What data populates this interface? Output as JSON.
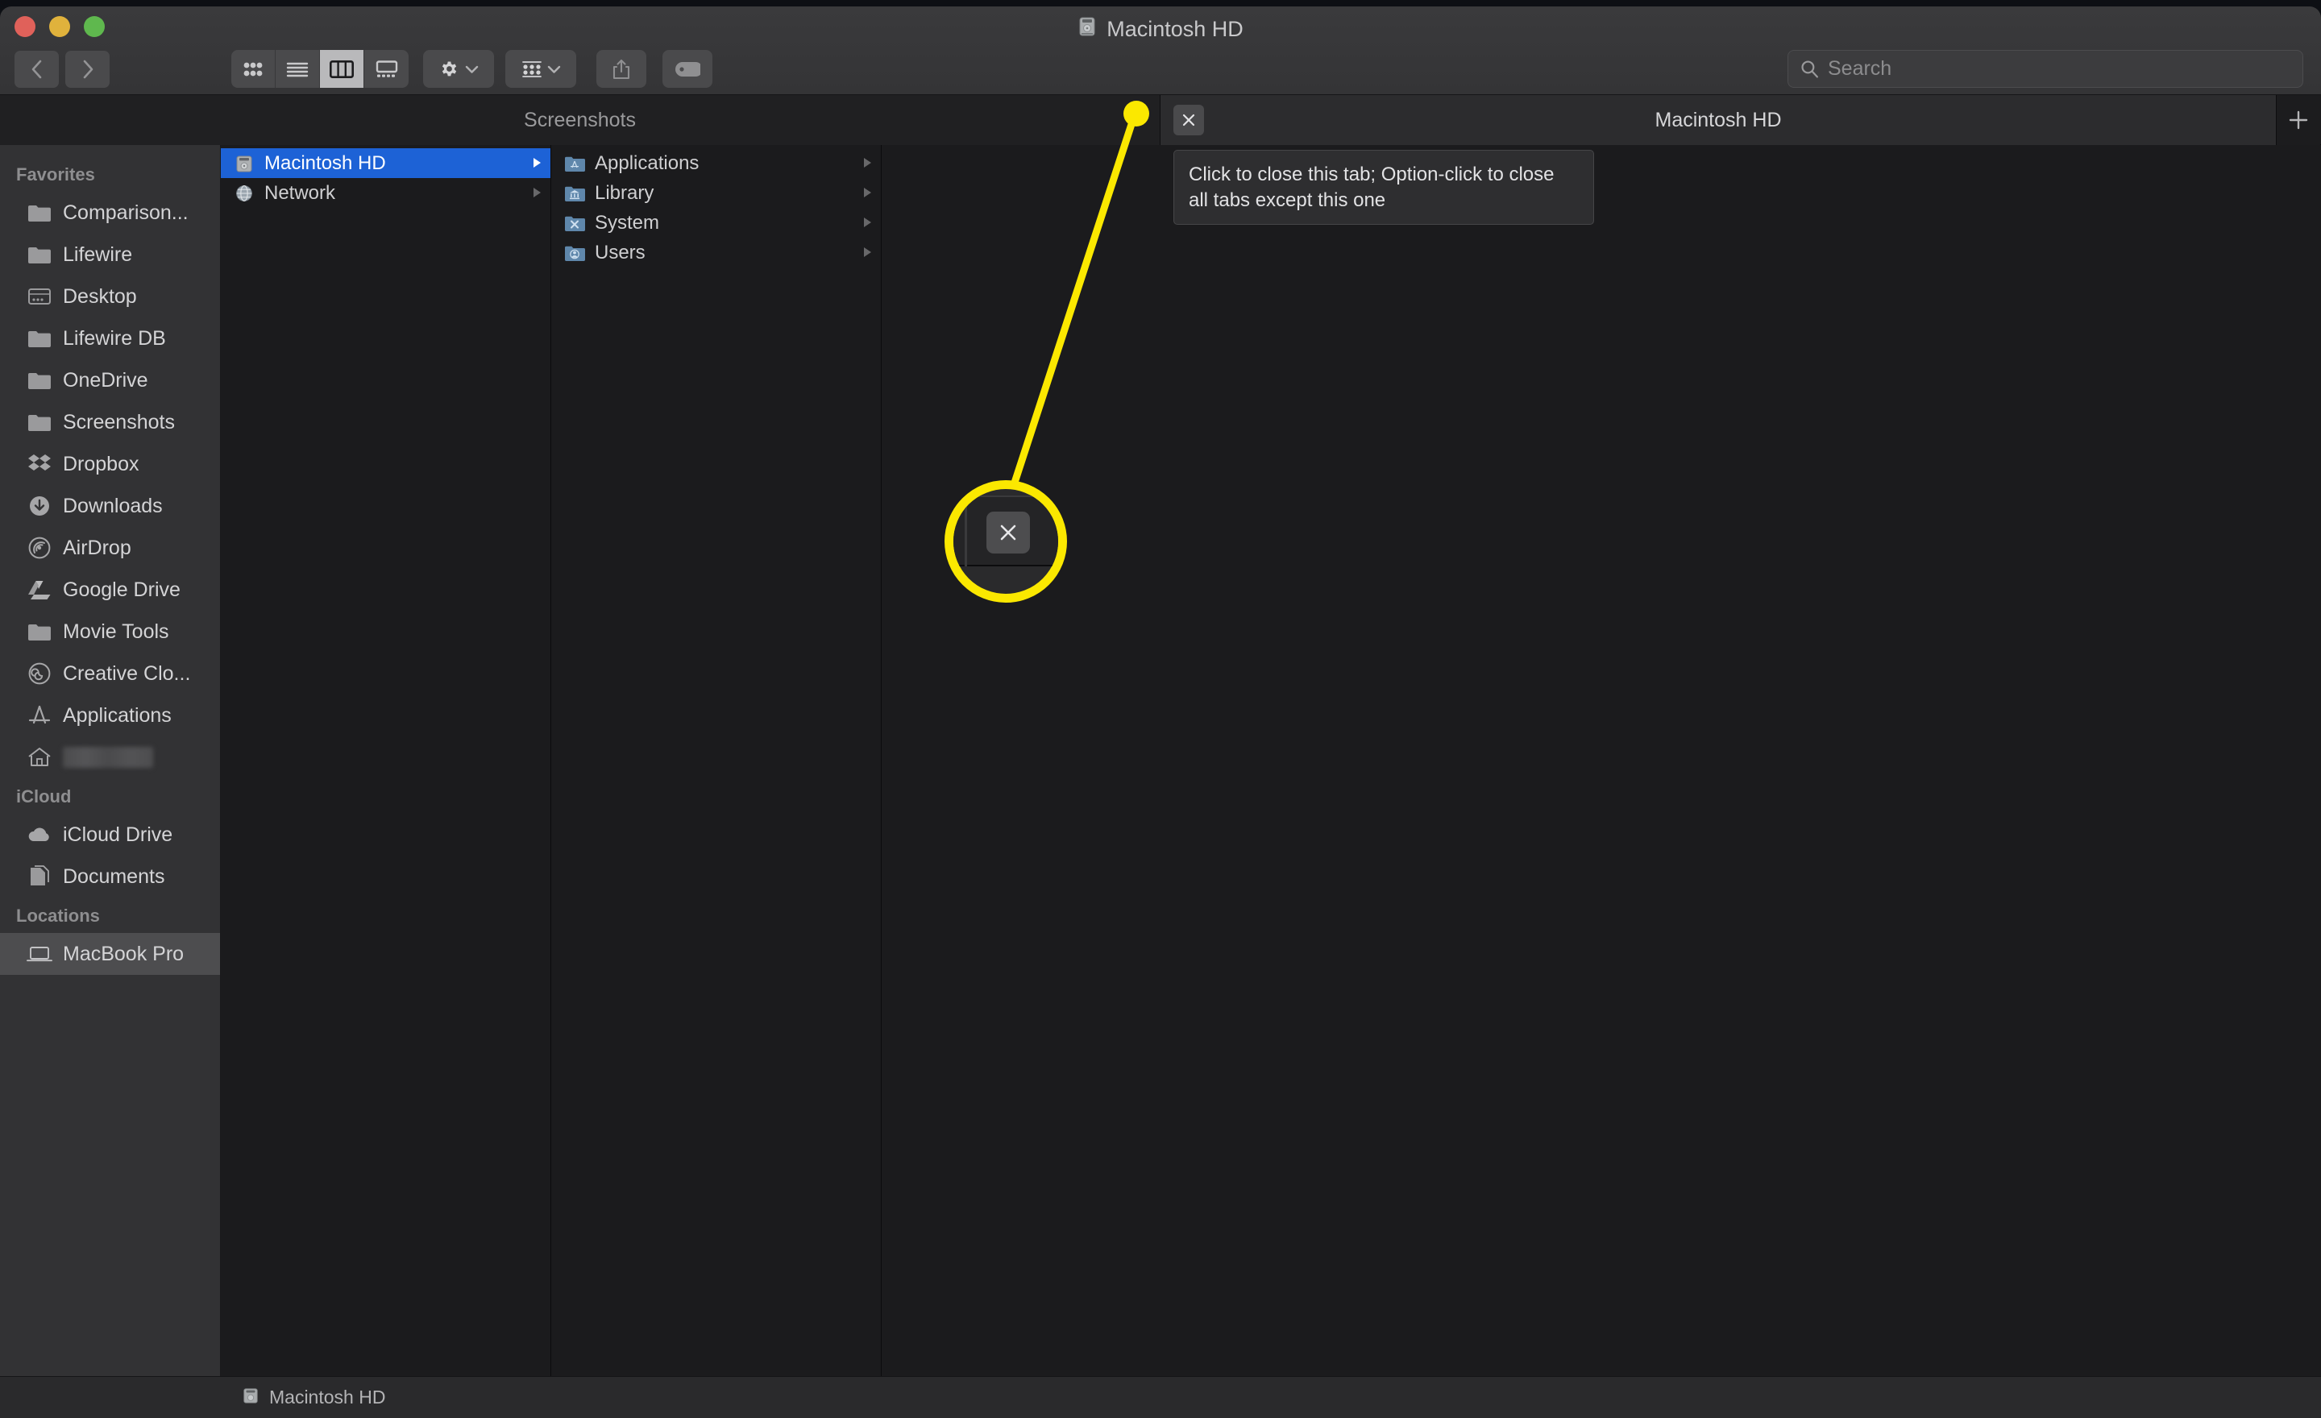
{
  "window": {
    "title": "Macintosh HD",
    "title_icon": "hard-drive-icon",
    "traffic_lights": [
      "close",
      "minimize",
      "zoom"
    ]
  },
  "toolbar": {
    "back_label": "Back",
    "forward_label": "Forward",
    "view_modes": [
      {
        "name": "icon-view",
        "label": "Icon View",
        "active": false
      },
      {
        "name": "list-view",
        "label": "List View",
        "active": false
      },
      {
        "name": "column-view",
        "label": "Column View",
        "active": true
      },
      {
        "name": "gallery-view",
        "label": "Gallery View",
        "active": false
      }
    ],
    "action_label": "Action",
    "arrange_label": "Arrange By",
    "share_label": "Share",
    "tags_label": "Edit Tags"
  },
  "search": {
    "placeholder": "Search",
    "value": ""
  },
  "tabs": {
    "items": [
      {
        "label": "Screenshots",
        "active": false,
        "has_close": false
      },
      {
        "label": "Macintosh HD",
        "active": true,
        "has_close": true
      }
    ],
    "new_tab_label": "+",
    "close_label": "✕"
  },
  "tooltip": {
    "text": "Click to close this tab; Option-click to close all tabs except this one"
  },
  "sidebar": {
    "sections": [
      {
        "header": "Favorites",
        "items": [
          {
            "label": "Comparison...",
            "icon": "folder-icon",
            "selected": false
          },
          {
            "label": "Lifewire",
            "icon": "folder-icon",
            "selected": false
          },
          {
            "label": "Desktop",
            "icon": "desktop-icon",
            "selected": false
          },
          {
            "label": "Lifewire DB",
            "icon": "folder-icon",
            "selected": false
          },
          {
            "label": "OneDrive",
            "icon": "folder-icon",
            "selected": false
          },
          {
            "label": "Screenshots",
            "icon": "folder-icon",
            "selected": false
          },
          {
            "label": "Dropbox",
            "icon": "dropbox-icon",
            "selected": false
          },
          {
            "label": "Downloads",
            "icon": "downloads-icon",
            "selected": false
          },
          {
            "label": "AirDrop",
            "icon": "airdrop-icon",
            "selected": false
          },
          {
            "label": "Google Drive",
            "icon": "google-drive-icon",
            "selected": false
          },
          {
            "label": "Movie Tools",
            "icon": "folder-icon",
            "selected": false
          },
          {
            "label": "Creative Clo...",
            "icon": "creative-cloud-icon",
            "selected": false
          },
          {
            "label": "Applications",
            "icon": "applications-icon",
            "selected": false
          },
          {
            "label": "",
            "icon": "home-icon",
            "selected": false,
            "redacted": true
          }
        ]
      },
      {
        "header": "iCloud",
        "items": [
          {
            "label": "iCloud Drive",
            "icon": "cloud-icon",
            "selected": false
          },
          {
            "label": "Documents",
            "icon": "documents-icon",
            "selected": false
          }
        ]
      },
      {
        "header": "Locations",
        "items": [
          {
            "label": "MacBook Pro",
            "icon": "laptop-icon",
            "selected": true
          }
        ]
      }
    ]
  },
  "columns": [
    {
      "name": "column-volumes",
      "rows": [
        {
          "label": "Macintosh HD",
          "icon": "hard-drive-icon",
          "selected": true,
          "disclosure": true
        },
        {
          "label": "Network",
          "icon": "network-globe-icon",
          "selected": false,
          "disclosure": true
        }
      ]
    },
    {
      "name": "column-root",
      "rows": [
        {
          "label": "Applications",
          "icon": "folder-applications-icon",
          "selected": false,
          "disclosure": true
        },
        {
          "label": "Library",
          "icon": "folder-library-icon",
          "selected": false,
          "disclosure": true
        },
        {
          "label": "System",
          "icon": "folder-system-icon",
          "selected": false,
          "disclosure": true
        },
        {
          "label": "Users",
          "icon": "folder-users-icon",
          "selected": false,
          "disclosure": true
        }
      ]
    },
    {
      "name": "column-preview",
      "rows": []
    }
  ],
  "status_bar": {
    "label": "Macintosh HD",
    "icon": "hard-drive-icon"
  },
  "annotation": {
    "color": "#fbe800",
    "callout_glyph": "✕",
    "description": "Yellow highlight circle magnifying the tab close button, connected by a leader line to a dot on the tab bar"
  }
}
